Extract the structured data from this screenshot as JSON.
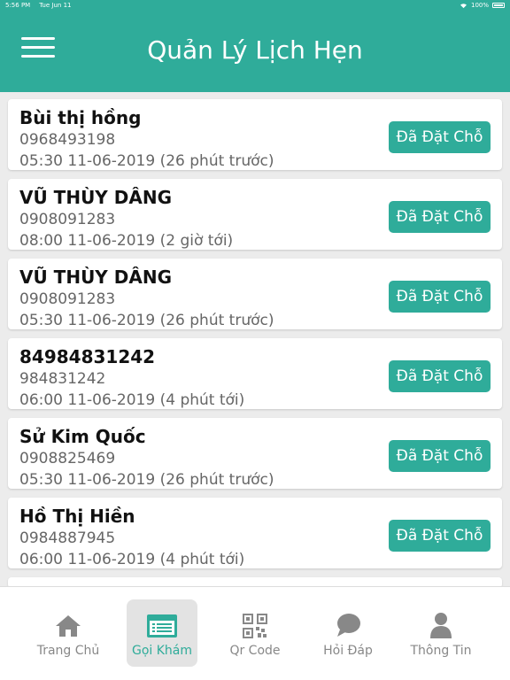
{
  "status_bar": {
    "time": "5:56 PM",
    "date": "Tue Jun 11",
    "battery": "100%"
  },
  "header": {
    "title": "Quản Lý Lịch Hẹn"
  },
  "appointments": [
    {
      "name": "Bùi thị hồng",
      "phone": "0968493198",
      "time": "05:30 11-06-2019 (26 phút trước)",
      "status": "Đã Đặt Chỗ"
    },
    {
      "name": "VŨ THÙY DÂNG",
      "phone": "0908091283",
      "time": "08:00 11-06-2019 (2 giờ tới)",
      "status": "Đã Đặt Chỗ"
    },
    {
      "name": "VŨ THÙY DÂNG",
      "phone": "0908091283",
      "time": "05:30 11-06-2019 (26 phút trước)",
      "status": "Đã Đặt Chỗ"
    },
    {
      "name": "84984831242",
      "phone": "984831242",
      "time": "06:00 11-06-2019 (4 phút tới)",
      "status": "Đã Đặt Chỗ"
    },
    {
      "name": "Sử Kim Quốc",
      "phone": "0908825469",
      "time": "05:30 11-06-2019 (26 phút trước)",
      "status": "Đã Đặt Chỗ"
    },
    {
      "name": "Hồ Thị Hiền",
      "phone": "0984887945",
      "time": "06:00 11-06-2019 (4 phút tới)",
      "status": "Đã Đặt Chỗ"
    }
  ],
  "tabs": [
    {
      "label": "Trang Chủ",
      "icon": "home-icon",
      "active": false
    },
    {
      "label": "Gọi Khám",
      "icon": "list-card-icon",
      "active": true
    },
    {
      "label": "Qr Code",
      "icon": "qr-code-icon",
      "active": false
    },
    {
      "label": "Hỏi Đáp",
      "icon": "chat-bubble-icon",
      "active": false
    },
    {
      "label": "Thông Tin",
      "icon": "person-icon",
      "active": false
    }
  ],
  "colors": {
    "primary": "#2fac9a",
    "tab_inactive": "#888888",
    "background": "#ececec"
  }
}
